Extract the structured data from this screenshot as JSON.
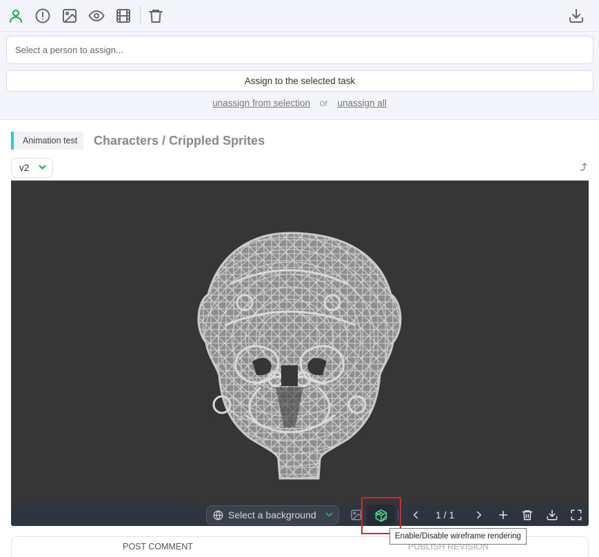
{
  "toolbar": {
    "icons": [
      "person-icon",
      "alert-circle-icon",
      "image-icon",
      "eye-icon",
      "film-icon",
      "trash-icon",
      "download-icon"
    ],
    "active_color": "#00b242"
  },
  "assign": {
    "placeholder": "Select a person to assign...",
    "button_label": "Assign to the selected task",
    "unassign_selection": "unassign from selection",
    "or": "or",
    "unassign_all": "unassign all"
  },
  "entity": {
    "task_type": "Animation test",
    "task_type_color": "#33c5d4",
    "title": "Characters / Crippled Sprites"
  },
  "revision": {
    "selected": "v2"
  },
  "player": {
    "background_placeholder": "Select a background",
    "frame": "1 / 1",
    "tooltip": "Enable/Disable wireframe rendering",
    "wireframe_color": "#4ade80"
  },
  "tabs": {
    "post_comment": "POST COMMENT",
    "publish_revision": "PUBLISH REVISION"
  }
}
